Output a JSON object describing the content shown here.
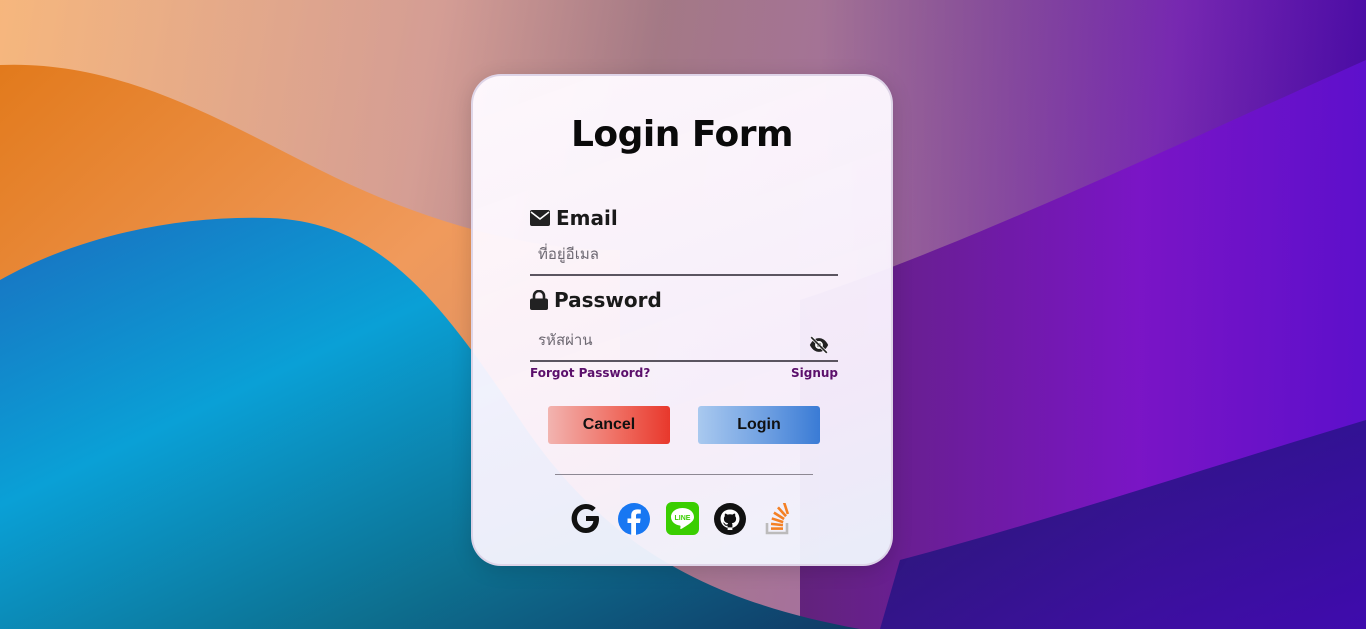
{
  "form": {
    "title": "Login Form",
    "email": {
      "label": "Email",
      "icon": "envelope-icon",
      "placeholder": "ที่อยู่อีเมล",
      "value": ""
    },
    "password": {
      "label": "Password",
      "icon": "lock-icon",
      "placeholder": "รหัสผ่าน",
      "value": "",
      "toggle_icon": "eye-slash-icon"
    },
    "links": {
      "forgot": "Forgot Password?",
      "signup": "Signup"
    },
    "buttons": {
      "cancel": "Cancel",
      "login": "Login"
    },
    "socials": [
      {
        "name": "google",
        "icon": "google-icon"
      },
      {
        "name": "facebook",
        "icon": "facebook-icon",
        "color": "#1877f2"
      },
      {
        "name": "line",
        "icon": "line-icon",
        "color": "#3ace01",
        "text": "LINE"
      },
      {
        "name": "github",
        "icon": "github-icon",
        "color": "#111111"
      },
      {
        "name": "stackoverflow",
        "icon": "stackoverflow-icon",
        "color": "#f48024"
      }
    ]
  },
  "colors": {
    "link": "#5b0f6b",
    "cancel_gradient_end": "#e8382c",
    "login_gradient_end": "#3a7bd5"
  }
}
